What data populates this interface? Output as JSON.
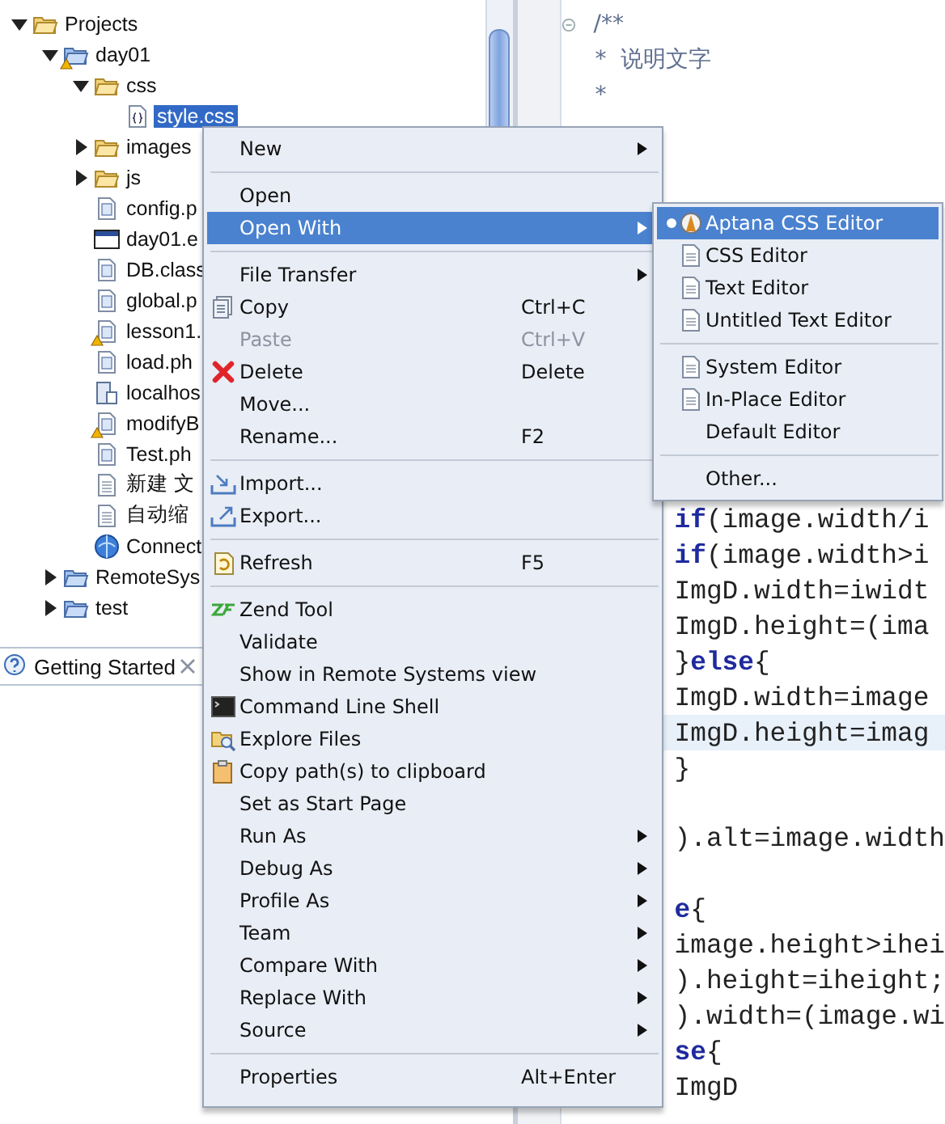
{
  "tree": [
    {
      "label": "Projects",
      "kind": "folder",
      "expanded": true,
      "selected": false,
      "warning": false,
      "children": [
        {
          "label": "day01",
          "kind": "project",
          "expanded": true,
          "selected": false,
          "warning": true,
          "children": [
            {
              "label": "css",
              "kind": "folder",
              "expanded": true,
              "selected": false,
              "warning": false,
              "children": [
                {
                  "label": "style.css",
                  "kind": "css",
                  "selected": true,
                  "warning": false
                }
              ]
            },
            {
              "label": "images",
              "kind": "folder",
              "expanded": false,
              "selected": false,
              "warning": false
            },
            {
              "label": "js",
              "kind": "folder",
              "expanded": false,
              "selected": false,
              "warning": false
            },
            {
              "label": "config.p",
              "kind": "php",
              "selected": false,
              "warning": false
            },
            {
              "label": "day01.e",
              "kind": "web",
              "selected": false,
              "warning": false
            },
            {
              "label": "DB.class",
              "kind": "php",
              "selected": false,
              "warning": false
            },
            {
              "label": "global.p",
              "kind": "php",
              "selected": false,
              "warning": false
            },
            {
              "label": "lesson1.",
              "kind": "php",
              "selected": false,
              "warning": true
            },
            {
              "label": "load.ph",
              "kind": "php",
              "selected": false,
              "warning": false
            },
            {
              "label": "localhos",
              "kind": "server",
              "selected": false,
              "warning": false
            },
            {
              "label": "modifyB",
              "kind": "php",
              "selected": false,
              "warning": true
            },
            {
              "label": "Test.ph",
              "kind": "php",
              "selected": false,
              "warning": false
            },
            {
              "label": "新建 文",
              "kind": "doc",
              "selected": false,
              "warning": false
            },
            {
              "label": "自动缩",
              "kind": "doc",
              "selected": false,
              "warning": false
            },
            {
              "label": "Connect",
              "kind": "globe",
              "selected": false,
              "warning": false
            }
          ]
        },
        {
          "label": "RemoteSys",
          "kind": "project",
          "expanded": false,
          "selected": false,
          "warning": false
        },
        {
          "label": "test",
          "kind": "project",
          "expanded": false,
          "selected": false,
          "warning": false
        }
      ]
    }
  ],
  "view_tab": {
    "label": "Getting Started"
  },
  "editor": {
    "comment_lines": [
      "/**",
      "*  说明文字",
      "*"
    ],
    "code_lines": [
      {
        "kind": "code",
        "current": false,
        "tokens": [
          {
            "text": "if",
            "keyword": true
          },
          {
            "text": "(image.width/i",
            "keyword": false
          }
        ]
      },
      {
        "kind": "code",
        "current": false,
        "tokens": [
          {
            "text": "if",
            "keyword": true
          },
          {
            "text": "(image.width>i",
            "keyword": false
          }
        ]
      },
      {
        "kind": "code",
        "current": false,
        "tokens": [
          {
            "text": "ImgD.width=iwidt",
            "keyword": false
          }
        ]
      },
      {
        "kind": "code",
        "current": false,
        "tokens": [
          {
            "text": "ImgD.height=(ima",
            "keyword": false
          }
        ]
      },
      {
        "kind": "code",
        "current": false,
        "tokens": [
          {
            "text": "}",
            "keyword": false
          },
          {
            "text": "else",
            "keyword": true
          },
          {
            "text": "{",
            "keyword": false
          }
        ]
      },
      {
        "kind": "code",
        "current": false,
        "tokens": [
          {
            "text": "ImgD.width=image",
            "keyword": false
          }
        ]
      },
      {
        "kind": "code",
        "current": true,
        "tokens": [
          {
            "text": "ImgD.height=imag",
            "keyword": false
          }
        ]
      },
      {
        "kind": "code",
        "current": false,
        "tokens": [
          {
            "text": "}",
            "keyword": false
          }
        ]
      },
      {
        "kind": "blank",
        "current": false
      },
      {
        "kind": "code",
        "current": false,
        "tokens": [
          {
            "text": ").alt=image.width",
            "keyword": false
          }
        ]
      },
      {
        "kind": "blank",
        "current": false
      },
      {
        "kind": "code",
        "current": false,
        "tokens": [
          {
            "text": "e",
            "keyword": true
          },
          {
            "text": "{",
            "keyword": false
          }
        ]
      },
      {
        "kind": "code",
        "current": false,
        "tokens": [
          {
            "text": "image.height>ihei",
            "keyword": false
          }
        ]
      },
      {
        "kind": "code",
        "current": false,
        "tokens": [
          {
            "text": ").height=iheight;",
            "keyword": false
          }
        ]
      },
      {
        "kind": "code",
        "current": false,
        "tokens": [
          {
            "text": ").width=(image.wi",
            "keyword": false
          }
        ]
      },
      {
        "kind": "code",
        "current": false,
        "tokens": [
          {
            "text": "se",
            "keyword": true
          },
          {
            "text": "{",
            "keyword": false
          }
        ]
      },
      {
        "kind": "code",
        "current": false,
        "tokens": [
          {
            "text": "ImgD",
            "keyword": false
          }
        ]
      }
    ]
  },
  "context_menu": {
    "items": [
      {
        "kind": "item",
        "label": "New",
        "submenu": true,
        "disabled": false,
        "selected": false
      },
      {
        "kind": "separator"
      },
      {
        "kind": "item",
        "label": "Open",
        "submenu": false,
        "disabled": false,
        "selected": false
      },
      {
        "kind": "item",
        "label": "Open With",
        "submenu": true,
        "disabled": false,
        "selected": true
      },
      {
        "kind": "separator"
      },
      {
        "kind": "item",
        "label": "File Transfer",
        "submenu": true,
        "disabled": false,
        "selected": false
      },
      {
        "kind": "item",
        "label": "Copy",
        "shortcut": "Ctrl+C",
        "submenu": false,
        "disabled": false,
        "selected": false
      },
      {
        "kind": "item",
        "label": "Paste",
        "shortcut": "Ctrl+V",
        "submenu": false,
        "disabled": true,
        "selected": false
      },
      {
        "kind": "item",
        "label": "Delete",
        "shortcut": "Delete",
        "submenu": false,
        "disabled": false,
        "selected": false
      },
      {
        "kind": "item",
        "label": "Move...",
        "submenu": false,
        "disabled": false,
        "selected": false
      },
      {
        "kind": "item",
        "label": "Rename...",
        "shortcut": "F2",
        "submenu": false,
        "disabled": false,
        "selected": false
      },
      {
        "kind": "separator"
      },
      {
        "kind": "item",
        "label": "Import...",
        "submenu": false,
        "disabled": false,
        "selected": false
      },
      {
        "kind": "item",
        "label": "Export...",
        "submenu": false,
        "disabled": false,
        "selected": false
      },
      {
        "kind": "separator"
      },
      {
        "kind": "item",
        "label": "Refresh",
        "shortcut": "F5",
        "submenu": false,
        "disabled": false,
        "selected": false
      },
      {
        "kind": "separator"
      },
      {
        "kind": "item",
        "label": "Zend Tool",
        "submenu": false,
        "disabled": false,
        "selected": false
      },
      {
        "kind": "item",
        "label": "Validate",
        "submenu": false,
        "disabled": false,
        "selected": false
      },
      {
        "kind": "item",
        "label": "Show in Remote Systems view",
        "submenu": false,
        "disabled": false,
        "selected": false
      },
      {
        "kind": "item",
        "label": "Command Line Shell",
        "submenu": false,
        "disabled": false,
        "selected": false
      },
      {
        "kind": "item",
        "label": "Explore Files",
        "submenu": false,
        "disabled": false,
        "selected": false
      },
      {
        "kind": "item",
        "label": "Copy path(s) to clipboard",
        "submenu": false,
        "disabled": false,
        "selected": false
      },
      {
        "kind": "item",
        "label": "Set as Start Page",
        "submenu": false,
        "disabled": false,
        "selected": false
      },
      {
        "kind": "item",
        "label": "Run As",
        "submenu": true,
        "disabled": false,
        "selected": false
      },
      {
        "kind": "item",
        "label": "Debug As",
        "submenu": true,
        "disabled": false,
        "selected": false
      },
      {
        "kind": "item",
        "label": "Profile As",
        "submenu": true,
        "disabled": false,
        "selected": false
      },
      {
        "kind": "item",
        "label": "Team",
        "submenu": true,
        "disabled": false,
        "selected": false
      },
      {
        "kind": "item",
        "label": "Compare With",
        "submenu": true,
        "disabled": false,
        "selected": false
      },
      {
        "kind": "item",
        "label": "Replace With",
        "submenu": true,
        "disabled": false,
        "selected": false
      },
      {
        "kind": "item",
        "label": "Source",
        "submenu": true,
        "disabled": false,
        "selected": false
      },
      {
        "kind": "separator"
      },
      {
        "kind": "item",
        "label": "Properties",
        "shortcut": "Alt+Enter",
        "submenu": false,
        "disabled": false,
        "selected": false
      }
    ]
  },
  "submenu": {
    "items": [
      {
        "kind": "item",
        "label": "Aptana CSS Editor",
        "selected": true
      },
      {
        "kind": "item",
        "label": "CSS Editor",
        "selected": false
      },
      {
        "kind": "item",
        "label": "Text Editor",
        "selected": false
      },
      {
        "kind": "item",
        "label": "Untitled Text Editor",
        "selected": false
      },
      {
        "kind": "separator"
      },
      {
        "kind": "item",
        "label": "System Editor",
        "selected": false
      },
      {
        "kind": "item",
        "label": "In-Place Editor",
        "selected": false
      },
      {
        "kind": "item",
        "label": "Default Editor",
        "selected": false
      },
      {
        "kind": "separator"
      },
      {
        "kind": "item",
        "label": "Other...",
        "selected": false
      }
    ]
  }
}
